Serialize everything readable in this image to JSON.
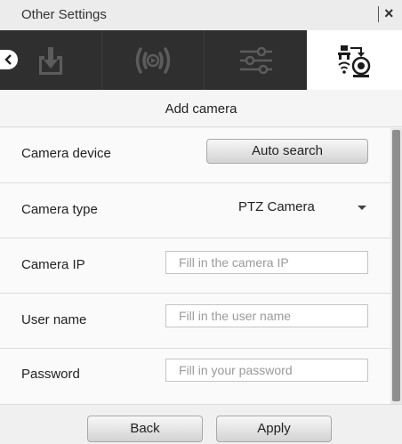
{
  "window": {
    "title": "Other Settings",
    "close_glyph": "×"
  },
  "tabs": [
    {
      "icon": "download-icon",
      "active": false
    },
    {
      "icon": "broadcast-icon",
      "active": false
    },
    {
      "icon": "sliders-icon",
      "active": false
    },
    {
      "icon": "network-camera-icon",
      "active": true
    }
  ],
  "subheader": {
    "title": "Add camera"
  },
  "form": {
    "camera_device": {
      "label": "Camera device",
      "button_label": "Auto search"
    },
    "camera_type": {
      "label": "Camera type",
      "selected": "PTZ Camera"
    },
    "camera_ip": {
      "label": "Camera IP",
      "value": "",
      "placeholder": "Fill in the camera IP"
    },
    "user_name": {
      "label": "User name",
      "value": "",
      "placeholder": "Fill in the user name"
    },
    "password": {
      "label": "Password",
      "value": "",
      "placeholder": "Fill in your password"
    }
  },
  "footer": {
    "back_label": "Back",
    "apply_label": "Apply"
  },
  "colors": {
    "tab_strip": "#2f2f2f",
    "tab_active": "#ffffff",
    "icon_inactive": "#5c5c5c"
  }
}
